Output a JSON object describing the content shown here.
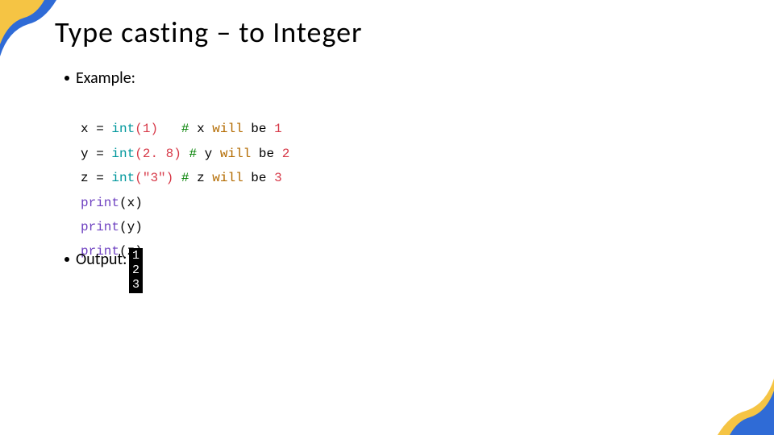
{
  "title": "Type casting – to Integer",
  "bullet_example": "Example:",
  "bullet_output": "Output:",
  "code": {
    "l1": {
      "var": "x",
      "eq": " = ",
      "fn": "int",
      "args": "(1)",
      "gap": "&nbsp;&nbsp;&nbsp;",
      "cmt_hash": "#",
      "cmt_pre": " x ",
      "cmt_will": "will",
      "cmt_be": " be ",
      "cmt_n": "1"
    },
    "l2": {
      "var": "y",
      "eq": " = ",
      "fn": "int",
      "args": "(2. 8)",
      "gap": " ",
      "cmt_hash": "#",
      "cmt_pre": " y ",
      "cmt_will": "will",
      "cmt_be": " be ",
      "cmt_n": "2"
    },
    "l3": {
      "var": "z",
      "eq": " = ",
      "fn": "int",
      "args": "(\"3\")",
      "gap": " ",
      "cmt_hash": "#",
      "cmt_pre": " z ",
      "cmt_will": "will",
      "cmt_be": " be ",
      "cmt_n": "3"
    },
    "p1": {
      "fn": "print",
      "args": "(x)"
    },
    "p2": {
      "fn": "print",
      "args": "(y)"
    },
    "p3": {
      "fn": "print",
      "args": "(z)"
    }
  },
  "output": {
    "v1": "1",
    "v2": "2",
    "v3": "3"
  }
}
